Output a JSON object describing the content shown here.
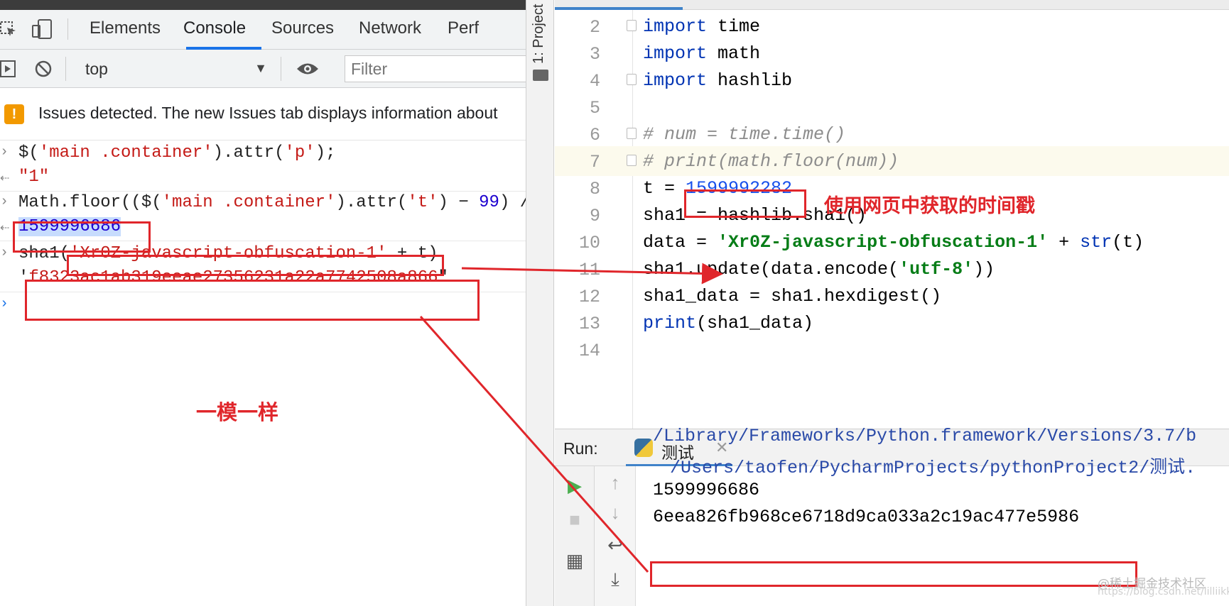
{
  "devtools": {
    "tabs": [
      "Elements",
      "Console",
      "Sources",
      "Network",
      "Perf"
    ],
    "active_tab": "Console",
    "context": "top",
    "filter_placeholder": "Filter",
    "issues_text": "Issues detected. The new Issues tab displays information about",
    "console": {
      "line1": {
        "pre": "$(",
        "s1": "'main .container'",
        "mid": ").attr(",
        "s2": "'p'",
        "post": ");"
      },
      "line2": "\"1\"",
      "line3": {
        "pre": "Math.floor(($(",
        "s1": "'main .container'",
        "mid": ").attr(",
        "s2": "'t'",
        "mid2": ") − ",
        "n": "99",
        "post": ") /"
      },
      "line4": "1599996686",
      "line5": {
        "pre": "sha1(",
        "s1": "'Xr0Z-javascript-obfuscation-1'",
        "post": " + t)"
      },
      "line6": {
        "q1": "'",
        "hash": "f8323ac1ab319eeae27356231a22a7742508a866",
        "q2": "\""
      }
    }
  },
  "ide": {
    "project_label": "1: Project",
    "code": {
      "l2": {
        "n": "2",
        "kw": "import",
        "rest": " time"
      },
      "l3": {
        "n": "3",
        "kw": "import",
        "rest": " math"
      },
      "l4": {
        "n": "4",
        "kw": "import",
        "rest": " hashlib"
      },
      "l5": {
        "n": "5"
      },
      "l6": {
        "n": "6",
        "comment": "# num = time.time()"
      },
      "l7": {
        "n": "7",
        "comment": "# print(math.floor(num))"
      },
      "l8": {
        "n": "8",
        "pre": "t = ",
        "num": "1599992282"
      },
      "l9": {
        "n": "9",
        "text": "sha1 = hashlib.sha1()"
      },
      "l10": {
        "n": "10",
        "pre": "data = ",
        "str": "'Xr0Z-javascript-obfuscation-1'",
        "mid": " + ",
        "fn": "str",
        "post": "(t)"
      },
      "l11": {
        "n": "11",
        "pre": "sha1.update(data.encode(",
        "str": "'utf-8'",
        "post": "))"
      },
      "l12": {
        "n": "12",
        "text": "sha1_data = sha1.hexdigest()"
      },
      "l13": {
        "n": "13",
        "fn": "print",
        "post": "(sha1_data)"
      },
      "l14": {
        "n": "14"
      }
    },
    "run": {
      "label": "Run:",
      "tab": "测试",
      "out1": "/Library/Frameworks/Python.framework/Versions/3.7/b",
      "out2": "/Users/taofen/PycharmProjects/pythonProject2/测试.",
      "out3": "1599996686",
      "out4": "6eea826fb968ce6718d9ca033a2c19ac477e5986"
    }
  },
  "annotations": {
    "timestamp_note": "使用网页中获取的时间戳",
    "same_note": "一模一样",
    "color": "#e0262b"
  },
  "watermark": "@稀土掘金技术社区",
  "watermark_url": "https://blog.csdn.net/lilliikkkkkoooooo"
}
